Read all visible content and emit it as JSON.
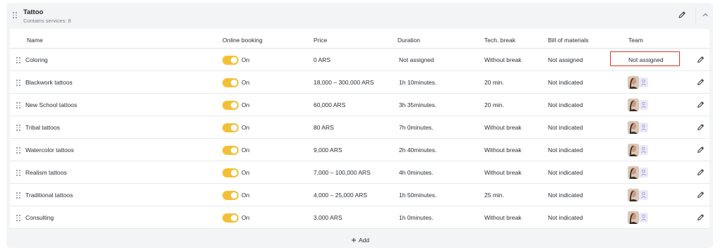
{
  "group": {
    "title": "Tattoo",
    "subtitle": "Contains services: 8"
  },
  "columns": {
    "name": "Name",
    "online_booking": "Online booking",
    "price": "Price",
    "duration": "Duration",
    "tech_break": "Tech. break",
    "bill_of_materials": "Bill of materials",
    "team": "Team"
  },
  "rows": [
    {
      "name": "Coloring",
      "online": "On",
      "online_enabled": true,
      "price": "0 ARS",
      "duration": "Not assigned",
      "tech_break": "Without break",
      "bom": "Not assigned",
      "team": "Not assigned"
    },
    {
      "name": "Blackwork tattoos",
      "online": "On",
      "online_enabled": true,
      "price": "18,000 – 300,000 ARS",
      "duration": "1h 10minutes.",
      "tech_break": "20 min.",
      "bom": "Not indicated",
      "team": ""
    },
    {
      "name": "New School tattoos",
      "online": "On",
      "online_enabled": true,
      "price": "60,000 ARS",
      "duration": "3h 35minutes.",
      "tech_break": "20 min.",
      "bom": "Not indicated",
      "team": ""
    },
    {
      "name": "Tribal tattoos",
      "online": "On",
      "online_enabled": true,
      "price": "80 ARS",
      "duration": "7h 0minutes.",
      "tech_break": "Without break",
      "bom": "Not indicated",
      "team": ""
    },
    {
      "name": "Watercolor tattoos",
      "online": "On",
      "online_enabled": true,
      "price": "9,000 ARS",
      "duration": "2h 40minutes.",
      "tech_break": "Without break",
      "bom": "Not indicated",
      "team": ""
    },
    {
      "name": "Realism tattoos",
      "online": "On",
      "online_enabled": true,
      "price": "7,000 – 100,000 ARS",
      "duration": "4h 0minutes.",
      "tech_break": "Without break",
      "bom": "Not indicated",
      "team": ""
    },
    {
      "name": "Traditional tattoos",
      "online": "On",
      "online_enabled": true,
      "price": "4,000 – 25,000 ARS",
      "duration": "1h 50minutes.",
      "tech_break": "25 min.",
      "bom": "Not indicated",
      "team": ""
    },
    {
      "name": "Consulting",
      "online": "On",
      "online_enabled": true,
      "price": "3,000 ARS",
      "duration": "1h 0minutes.",
      "tech_break": "Without break",
      "bom": "Not indicated",
      "team": ""
    }
  ],
  "add_label": "Add",
  "icons": {
    "drag": "drag-handle-icon",
    "edit": "pencil-icon",
    "collapse": "chevron-up-icon",
    "add": "plus-icon",
    "team_add": "person-add-icon"
  },
  "colors": {
    "toggle_on": "#f2c037",
    "highlight": "#d9342b",
    "panel_bg": "#f3f4f6"
  }
}
